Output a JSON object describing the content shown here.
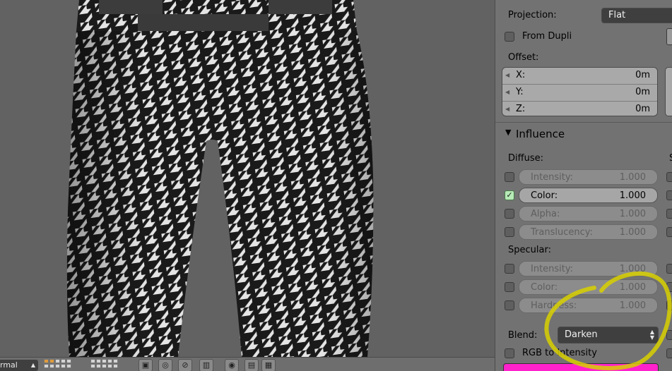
{
  "viewport": {
    "header": {
      "mode_label": "rmal"
    }
  },
  "panel": {
    "projection": {
      "label": "Projection:",
      "value": "Flat"
    },
    "from_dupli": {
      "label": "From Dupli",
      "checked": false
    },
    "offset": {
      "label": "Offset:",
      "fields": [
        {
          "axis": "X:",
          "value": "0m"
        },
        {
          "axis": "Y:",
          "value": "0m"
        },
        {
          "axis": "Z:",
          "value": "0m"
        }
      ]
    },
    "influence": {
      "title": "Influence",
      "diffuse": {
        "label": "Diffuse:",
        "items": [
          {
            "name": "Intensity:",
            "value": "1.000",
            "checked": false
          },
          {
            "name": "Color:",
            "value": "1.000",
            "checked": true
          },
          {
            "name": "Alpha:",
            "value": "1.000",
            "checked": false
          },
          {
            "name": "Translucency:",
            "value": "1.000",
            "checked": false
          }
        ]
      },
      "specular": {
        "label": "Specular:",
        "items": [
          {
            "name": "Intensity:",
            "value": "1.000",
            "checked": false
          },
          {
            "name": "Color:",
            "value": "1.000",
            "checked": false
          },
          {
            "name": "Hardness:",
            "value": "1.000",
            "checked": false
          }
        ]
      },
      "blend": {
        "label": "Blend:",
        "value": "Darken"
      },
      "rgb_to_intensity": {
        "label": "RGB to Intensity",
        "checked": false
      }
    }
  },
  "colors": {
    "annotation_circle": "#d8d000",
    "color_swatch": "#ff22cc",
    "checkbox_checked": "#b6eab6"
  }
}
